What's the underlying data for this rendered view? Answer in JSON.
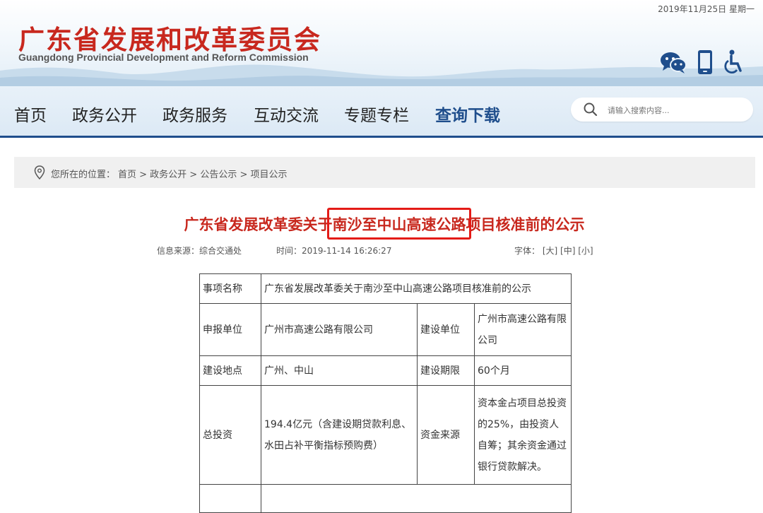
{
  "header": {
    "date": "2019年11月25日  星期一",
    "brand_cn": "广东省发展和改革委员会",
    "brand_en": "Guangdong Provincial Development and Reform Commission",
    "icons": [
      "wechat-icon",
      "mobile-icon",
      "accessibility-icon"
    ]
  },
  "nav": {
    "items": [
      "首页",
      "政务公开",
      "政务服务",
      "互动交流",
      "专题专栏",
      "查询下载"
    ],
    "active": "查询下载"
  },
  "search": {
    "placeholder": "请输入搜索内容..."
  },
  "breadcrumb": {
    "prefix": "您所在的位置：",
    "path": "首页 > 政务公开 > 公告公示 > 项目公示"
  },
  "article": {
    "title": "广东省发展改革委关于南沙至中山高速公路项目核准前的公示",
    "highlight": "南沙至中山高速公路",
    "source": "信息来源：综合交通处",
    "time": "时间：2019-11-14 16:26:27",
    "font_label": "字体：",
    "font_sizes": [
      "[大]",
      "[中]",
      "[小]"
    ]
  },
  "table": {
    "item_name_label": "事项名称",
    "item_name": "广东省发展改革委关于南沙至中山高速公路项目核准前的公示",
    "applicant_label": "申报单位",
    "applicant": "广州市高速公路有限公司",
    "builder_label": "建设单位",
    "builder": "广州市高速公路有限公司",
    "location_label": "建设地点",
    "location": "广州、中山",
    "period_label": "建设期限",
    "period": "60个月",
    "investment_label": "总投资",
    "investment": "194.4亿元（含建设期贷款利息、水田占补平衡指标预购费）",
    "funding_label": "资金来源",
    "funding": "资本金占项目总投资的25%，由投资人自筹；其余资金通过银行贷款解决。"
  },
  "colors": {
    "brand_red": "#c8281e",
    "nav_blue": "#1f4e8c",
    "highlight_box": "#e41b17"
  }
}
